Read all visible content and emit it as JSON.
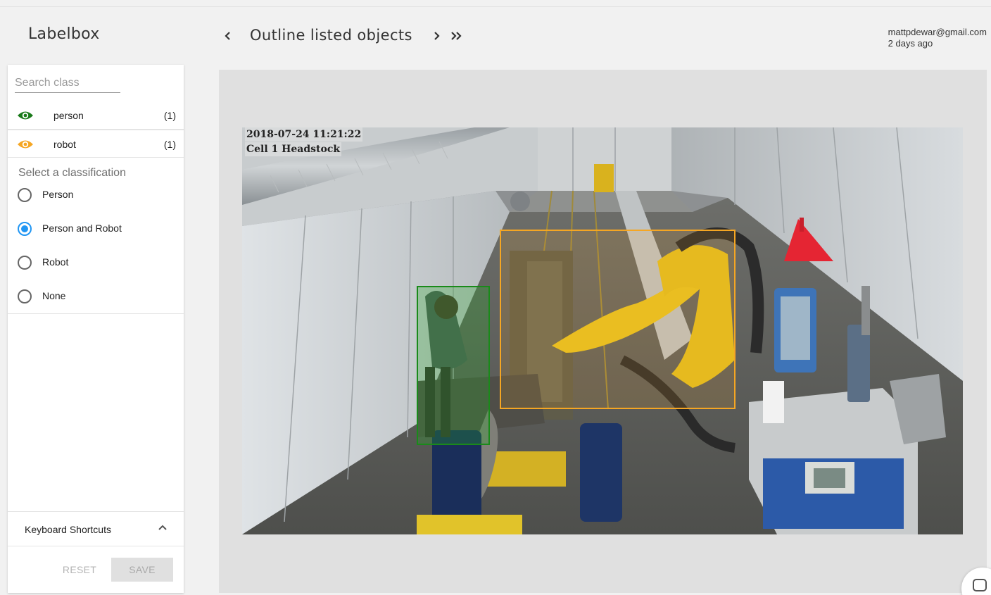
{
  "app": {
    "name": "Labelbox"
  },
  "header": {
    "title": "Outline listed objects",
    "user_email": "mattpdewar@gmail.com",
    "time_ago": "2 days ago",
    "prev_icon": "chevron-left-icon",
    "next_icon": "chevron-right-icon",
    "last_icon": "double-chevron-right-icon"
  },
  "sidebar": {
    "search": {
      "placeholder": "Search class",
      "value": ""
    },
    "classes": [
      {
        "name": "person",
        "count": "(1)",
        "color": "#1a7a1a",
        "icon": "eye-icon"
      },
      {
        "name": "robot",
        "count": "(1)",
        "color": "#f5a623",
        "icon": "eye-icon"
      }
    ],
    "classification_label": "Select a classification",
    "options": [
      {
        "label": "Person",
        "selected": false
      },
      {
        "label": "Person and Robot",
        "selected": true
      },
      {
        "label": "Robot",
        "selected": false
      },
      {
        "label": "None",
        "selected": false
      }
    ],
    "shortcuts_label": "Keyboard Shortcuts",
    "reset_label": "RESET",
    "save_label": "SAVE",
    "accent_color": "#2196f3"
  },
  "image": {
    "timestamp": "2018-07-24 11:21:22",
    "camera": "Cell 1 Headstock",
    "annotations": [
      {
        "class": "person",
        "color": "#1a8a1a"
      },
      {
        "class": "robot",
        "color": "#f5a623"
      }
    ]
  }
}
